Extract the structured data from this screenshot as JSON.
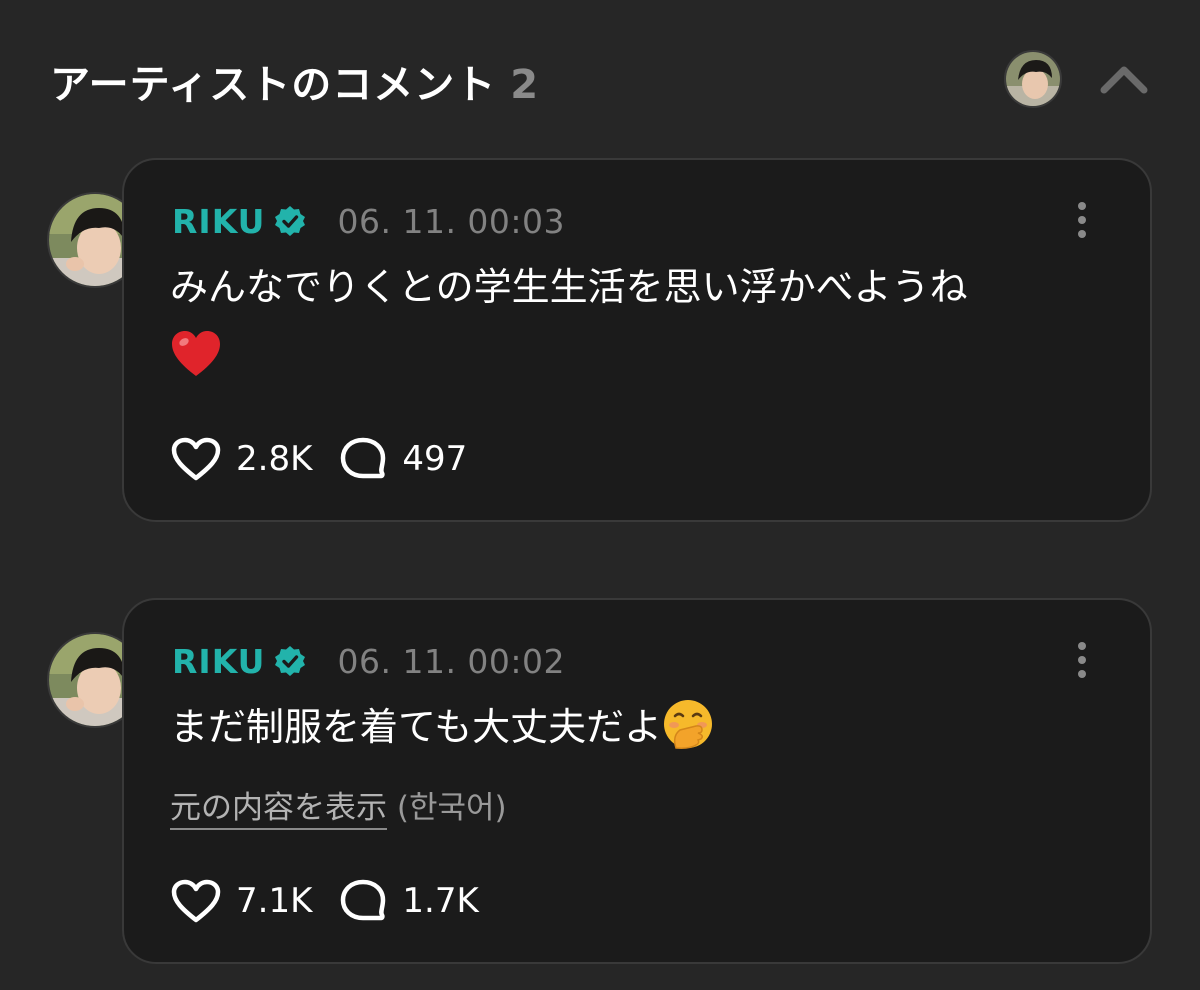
{
  "header": {
    "title": "アーティストのコメント",
    "count": "2"
  },
  "comments": [
    {
      "author": "RIKU",
      "timestamp": "06. 11. 00:03",
      "text": "みんなでりくとの学生生活を思い浮かべようね",
      "emoji": "red-heart",
      "likes": "2.8K",
      "replies": "497"
    },
    {
      "author": "RIKU",
      "timestamp": "06. 11. 00:02",
      "text": "まだ制服を着ても大丈夫だよ",
      "emoji": "face-with-hand-over-mouth",
      "show_original_label": "元の内容を表示",
      "original_language": "(한국어)",
      "likes": "7.1K",
      "replies": "1.7K"
    }
  ],
  "icons": {
    "verified": "verified-badge-icon",
    "like": "heart-icon",
    "reply": "comment-bubble-icon",
    "more": "more-vertical-icon",
    "collapse": "chevron-up-icon"
  },
  "colors": {
    "background": "#262626",
    "card": "#1b1b1b",
    "accent": "#22b3ab",
    "muted": "#828282"
  }
}
